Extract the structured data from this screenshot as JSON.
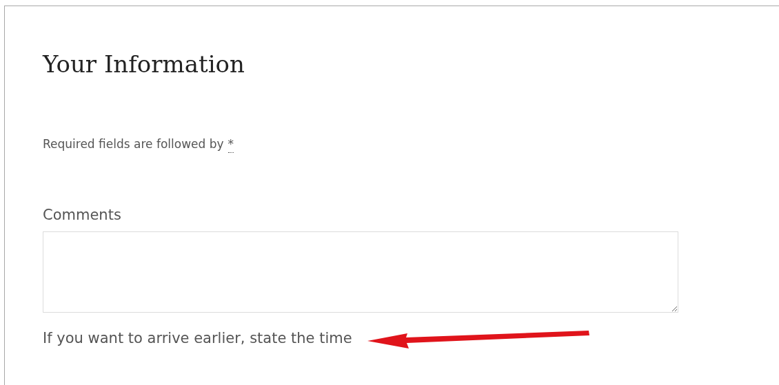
{
  "section": {
    "title": "Your Information"
  },
  "required_note": {
    "text": "Required fields are followed by",
    "marker": "*"
  },
  "comments_field": {
    "label": "Comments",
    "hint": "If you want to arrive earlier, state the time"
  }
}
